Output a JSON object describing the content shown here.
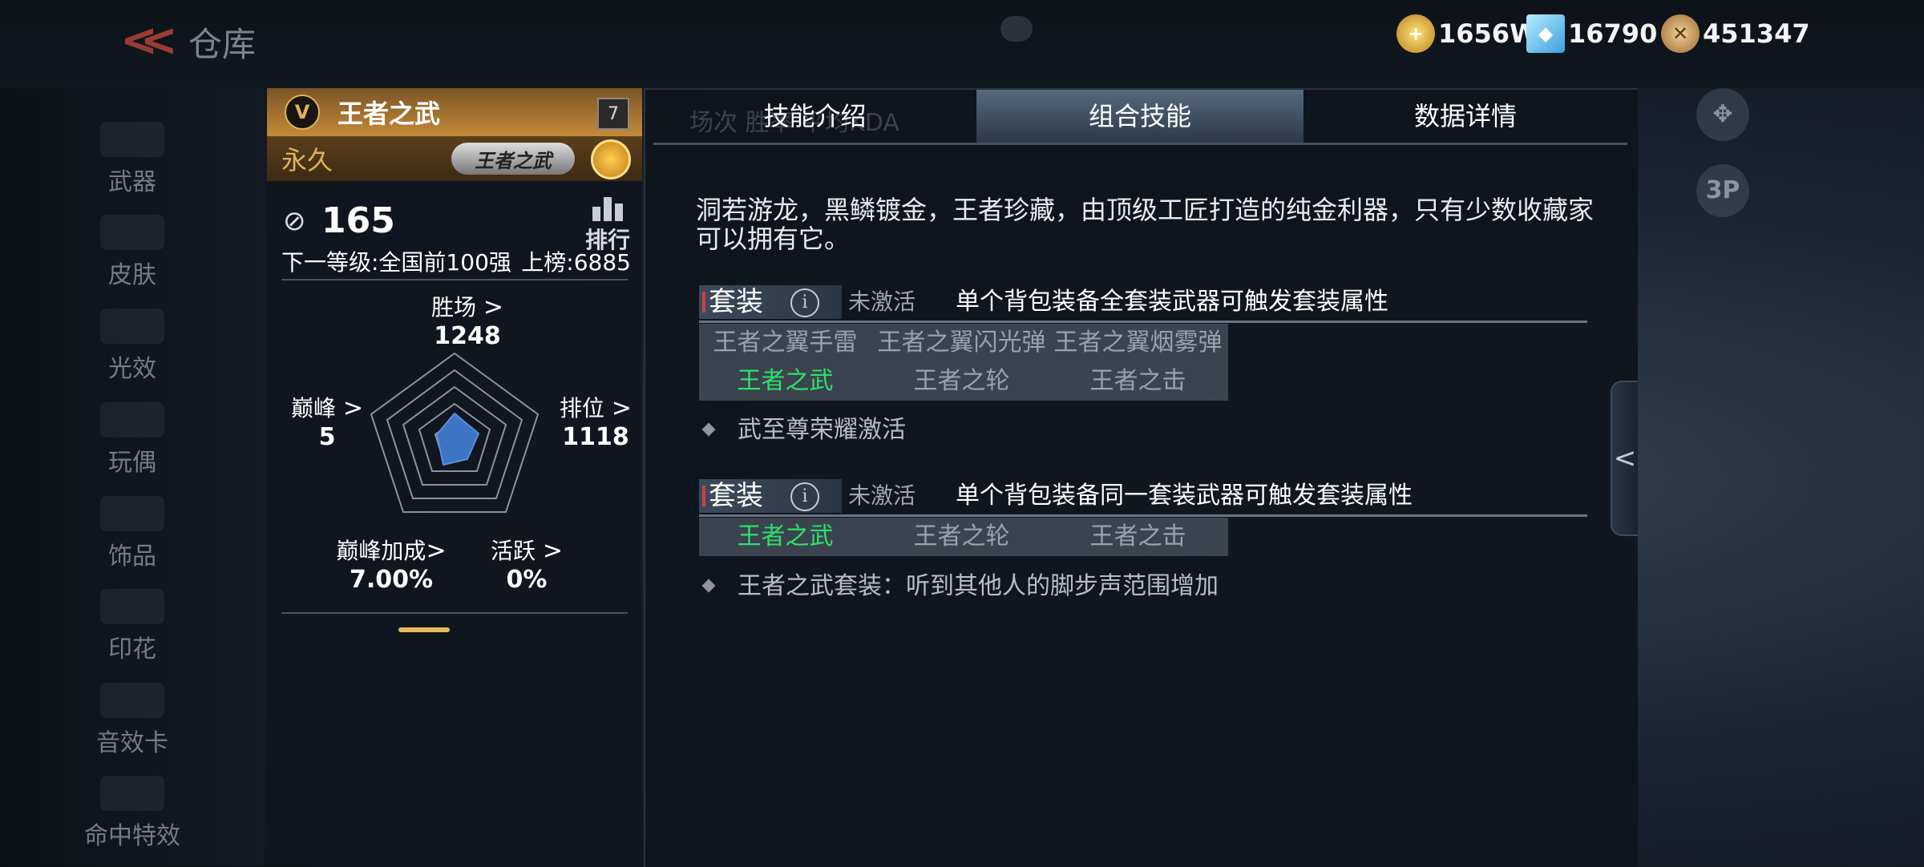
{
  "header": {
    "title": "仓库",
    "currencies": [
      {
        "icon": "gold-coin-icon",
        "value": "1656W",
        "color": "#d6a53a"
      },
      {
        "icon": "diamond-icon",
        "value": "16790",
        "color": "#6ac8f5"
      },
      {
        "icon": "badge-coin-icon",
        "value": "451347",
        "color": "#c89a58"
      }
    ]
  },
  "sidebar": {
    "items": [
      {
        "label": "武器"
      },
      {
        "label": "皮肤"
      },
      {
        "label": "光效"
      },
      {
        "label": "玩偶"
      },
      {
        "label": "饰品"
      },
      {
        "label": "印花"
      },
      {
        "label": "音效卡"
      },
      {
        "label": "命中特效"
      }
    ]
  },
  "weapon": {
    "name": "王者之武",
    "level": "7",
    "duration": "永久",
    "badge": "王者之武",
    "rank": "165",
    "rank_board": "排行",
    "next_level": "下一等级:全国前100强",
    "onboard": "上榜:6885",
    "stats": {
      "wins_label": "胜场",
      "wins": "1248",
      "ranked_label": "排位",
      "ranked": "1118",
      "peak_label": "巅峰",
      "peak": "5",
      "peak_bonus_label": "巅峰加成",
      "peak_bonus": "7.00%",
      "active_label": "活跃",
      "active": "0%"
    },
    "arrow": ">"
  },
  "tabs": [
    {
      "label": "技能介绍",
      "active": false
    },
    {
      "label": "组合技能",
      "active": true
    },
    {
      "label": "数据详情",
      "active": false
    }
  ],
  "ghost_stats": "场次     胜率     平均KDA",
  "description": "洞若游龙，黑鳞镀金，王者珍藏，由顶级工匠打造的纯金利器，只有少数收藏家可以拥有它。",
  "suits": [
    {
      "tag": "套装",
      "info": "i",
      "state": "未激活",
      "rule": "单个背包装备全套装武器可触发套装属性",
      "rows": [
        [
          {
            "name": "王者之翼手雷",
            "on": false
          },
          {
            "name": "王者之翼闪光弹",
            "on": false
          },
          {
            "name": "王者之翼烟雾弹",
            "on": false
          }
        ],
        [
          {
            "name": "王者之武",
            "on": true
          },
          {
            "name": "王者之轮",
            "on": false
          },
          {
            "name": "王者之击",
            "on": false
          }
        ]
      ],
      "effect": "武至尊荣耀激活"
    },
    {
      "tag": "套装",
      "info": "i",
      "state": "未激活",
      "rule": "单个背包装备同一套装武器可触发套装属性",
      "rows": [
        [
          {
            "name": "王者之武",
            "on": true
          },
          {
            "name": "王者之轮",
            "on": false
          },
          {
            "name": "王者之击",
            "on": false
          }
        ]
      ],
      "effect": "王者之武套装：听到其他人的脚步声范围增加"
    }
  ],
  "collapse_glyph": "<",
  "float_buttons": {
    "settings": "✥",
    "view": "3P"
  },
  "colors": {
    "active_item": "#2fe06a",
    "gold_header": "#c58a38",
    "progress": "#e6b85a"
  }
}
